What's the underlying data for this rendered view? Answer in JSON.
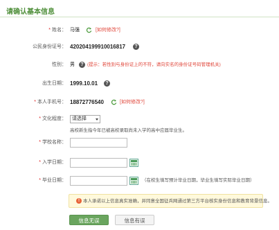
{
  "header": {
    "title": "请确认基本信息"
  },
  "name": {
    "label": "姓名：",
    "value": "马强",
    "edit_link": "[如何修改?]"
  },
  "id_number": {
    "label": "公民身份证号：",
    "value": "420204199910016817"
  },
  "gender": {
    "label": "性别：",
    "value": "男",
    "hint": "(提示：若性别与身份证上的不符，请向实名的身份证号码管理机关)"
  },
  "birth": {
    "label": "出生日期：",
    "value": "1999.10.01"
  },
  "phone": {
    "label": "本人手机号：",
    "value": "18872776540",
    "edit_link": "[如何修改?]"
  },
  "education": {
    "label": "文化程度：",
    "selected": "请选择",
    "note": "高校新生指今年已被高校录取尚未入学的高中应届毕业生。"
  },
  "school": {
    "label": "学校名称：",
    "value": ""
  },
  "enroll_date": {
    "label": "入学日期：",
    "value": ""
  },
  "grad_date": {
    "label": "毕业日期：",
    "value": "",
    "note": "（在校生填写预计毕业日期，毕业生填写实际毕业日期）"
  },
  "notice": {
    "text": "本人承诺以上信息真实准确，并同意全国征兵网通过第三方平台核实身份信息和教育背景信息。"
  },
  "buttons": {
    "confirm": "信息无误",
    "edit": "信息有误"
  },
  "colors": {
    "accent": "#6aa55e",
    "title": "#4f8f3a",
    "link": "#e0463a"
  }
}
